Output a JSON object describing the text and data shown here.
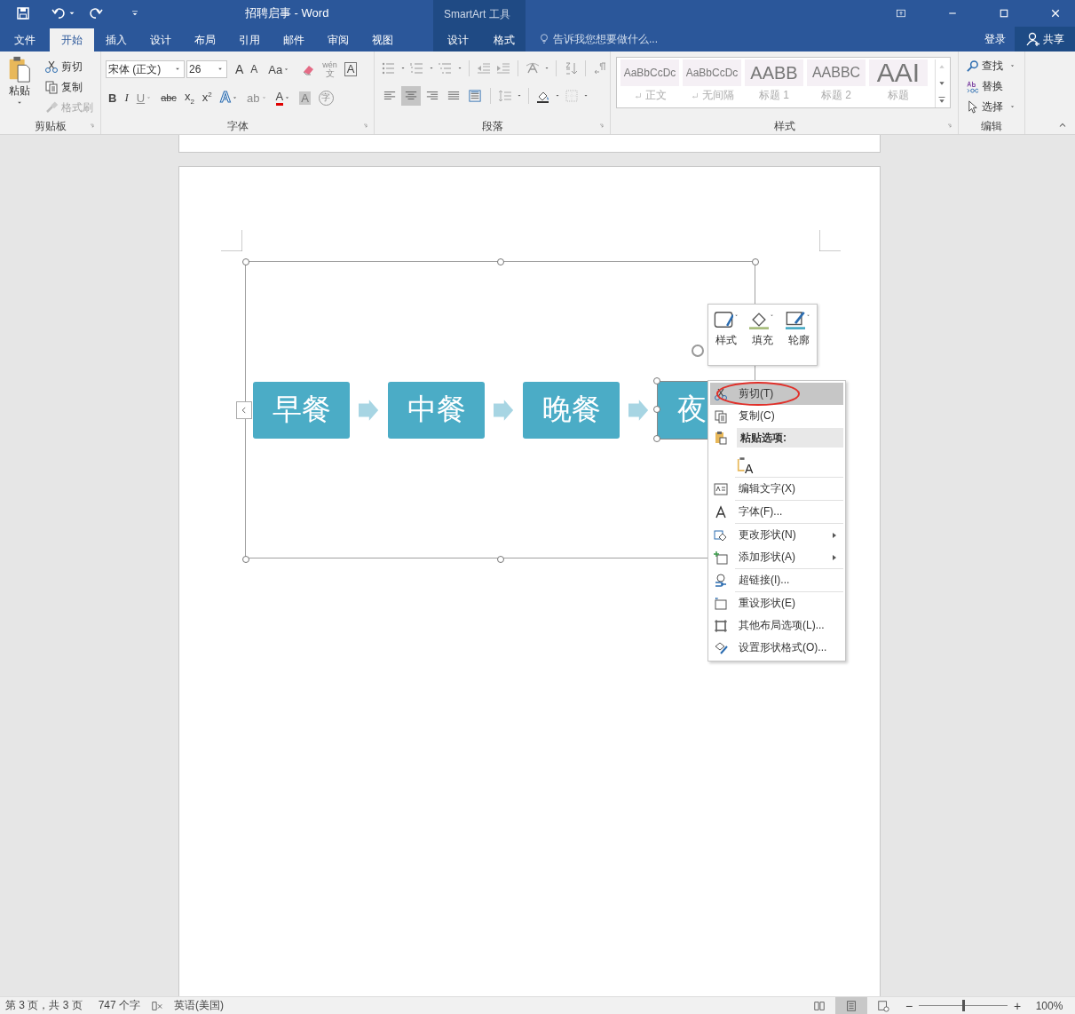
{
  "window": {
    "title": "招聘启事 - Word",
    "contextual_title": "SmartArt 工具",
    "tell_me": {
      "placeholder": "告诉我您想要做什么..."
    },
    "signin": "登录",
    "share": "共享"
  },
  "tabs": [
    {
      "label": "文件",
      "selected": false,
      "contextual": false
    },
    {
      "label": "开始",
      "selected": true,
      "contextual": false
    },
    {
      "label": "插入",
      "selected": false,
      "contextual": false
    },
    {
      "label": "设计",
      "selected": false,
      "contextual": false
    },
    {
      "label": "布局",
      "selected": false,
      "contextual": false
    },
    {
      "label": "引用",
      "selected": false,
      "contextual": false
    },
    {
      "label": "邮件",
      "selected": false,
      "contextual": false
    },
    {
      "label": "审阅",
      "selected": false,
      "contextual": false
    },
    {
      "label": "视图",
      "selected": false,
      "contextual": false
    },
    {
      "label": "设计",
      "selected": false,
      "contextual": true
    },
    {
      "label": "格式",
      "selected": false,
      "contextual": true
    }
  ],
  "ribbon": {
    "clipboard": {
      "label": "剪贴板",
      "paste": "粘贴",
      "items": [
        {
          "label": "剪切",
          "disabled": false
        },
        {
          "label": "复制",
          "disabled": false
        },
        {
          "label": "格式刷",
          "disabled": true
        }
      ]
    },
    "font": {
      "label": "字体",
      "name": "宋体 (正文)",
      "size": "26",
      "row1": [
        {
          "kind": "grow",
          "label": "A",
          "caret": false,
          "disabled": false
        },
        {
          "kind": "shrink",
          "label": "A",
          "caret": false,
          "disabled": false
        },
        {
          "kind": "case",
          "label": "Aa",
          "caret": true,
          "disabled": false
        },
        {
          "kind": "clear",
          "caret": false,
          "disabled": false
        },
        {
          "kind": "phonetic",
          "label": "wén",
          "sub": "文",
          "caret": false,
          "disabled": true
        },
        {
          "kind": "border",
          "label": "A",
          "caret": false,
          "disabled": false
        }
      ],
      "row2": [
        {
          "kind": "bold",
          "label": "B",
          "caret": false,
          "disabled": false
        },
        {
          "kind": "italic",
          "label": "I",
          "caret": false,
          "disabled": false
        },
        {
          "kind": "underline",
          "label": "U",
          "caret": true,
          "disabled": true
        },
        {
          "kind": "strike",
          "label": "abc",
          "caret": false,
          "disabled": false
        },
        {
          "kind": "subscript",
          "label": "x",
          "sub": "2",
          "caret": false,
          "disabled": false
        },
        {
          "kind": "superscript",
          "label": "x",
          "sup": "2",
          "caret": false,
          "disabled": false
        },
        {
          "kind": "effects",
          "label": "A",
          "caret": true,
          "disabled": false
        },
        {
          "kind": "highlight",
          "label": "ab",
          "caret": true,
          "disabled": true
        },
        {
          "kind": "color",
          "label": "A",
          "caret": true,
          "disabled": false
        },
        {
          "kind": "shading",
          "label": "A",
          "caret": false,
          "disabled": false
        },
        {
          "kind": "enclose",
          "label": "字",
          "caret": false,
          "disabled": false
        }
      ]
    },
    "paragraph": {
      "label": "段落",
      "align": [
        {
          "kind": "left",
          "selected": false
        },
        {
          "kind": "center",
          "selected": true
        },
        {
          "kind": "right",
          "selected": false
        },
        {
          "kind": "justify",
          "selected": false
        },
        {
          "kind": "distributed",
          "selected": false
        }
      ]
    },
    "styles": {
      "label": "样式",
      "items": [
        {
          "preview": "AaBbCcDc",
          "name": "正文",
          "kind": "body"
        },
        {
          "preview": "AaBbCcDc",
          "name": "无间隔",
          "kind": "body"
        },
        {
          "preview": "AABB",
          "name": "标题 1",
          "kind": "heading1"
        },
        {
          "preview": "AABBC",
          "name": "标题 2",
          "kind": "heading2"
        },
        {
          "preview": "AAI",
          "name": "标题",
          "kind": "title"
        }
      ]
    },
    "editing": {
      "label": "编辑",
      "items": [
        {
          "label": "查找",
          "caret": true
        },
        {
          "label": "替换",
          "caret": false
        },
        {
          "label": "选择",
          "caret": true
        }
      ]
    }
  },
  "document": {
    "smartart": {
      "shapes": [
        {
          "text": "早餐",
          "selected": false
        },
        {
          "text": "中餐",
          "selected": false
        },
        {
          "text": "晚餐",
          "selected": false
        },
        {
          "text": "夜",
          "selected": true
        }
      ]
    },
    "mini_toolbar": [
      {
        "label": "样式"
      },
      {
        "label": "填充"
      },
      {
        "label": "轮廓"
      }
    ],
    "context_menu": {
      "groups": [
        [
          {
            "kind": "item",
            "label": "剪切(T)",
            "selected": true,
            "circled": true,
            "submenu": false
          },
          {
            "kind": "item",
            "label": "复制(C)",
            "selected": false,
            "circled": false,
            "submenu": false
          },
          {
            "kind": "header",
            "label": "粘贴选项:"
          },
          {
            "kind": "paste-option",
            "label": "A"
          }
        ],
        [
          {
            "kind": "item",
            "label": "编辑文字(X)",
            "selected": false,
            "circled": false,
            "submenu": false
          }
        ],
        [
          {
            "kind": "item",
            "label": "字体(F)...",
            "selected": false,
            "circled": false,
            "submenu": false
          }
        ],
        [
          {
            "kind": "item",
            "label": "更改形状(N)",
            "selected": false,
            "circled": false,
            "submenu": true
          },
          {
            "kind": "item",
            "label": "添加形状(A)",
            "selected": false,
            "circled": false,
            "submenu": true
          }
        ],
        [
          {
            "kind": "item",
            "label": "超链接(I)...",
            "selected": false,
            "circled": false,
            "submenu": false
          }
        ],
        [
          {
            "kind": "item",
            "label": "重设形状(E)",
            "selected": false,
            "circled": false,
            "submenu": false
          },
          {
            "kind": "item",
            "label": "其他布局选项(L)...",
            "selected": false,
            "circled": false,
            "submenu": false
          },
          {
            "kind": "item",
            "label": "设置形状格式(O)...",
            "selected": false,
            "circled": false,
            "submenu": false
          }
        ]
      ]
    }
  },
  "status_bar": {
    "page": "第 3 页，共 3 页",
    "words": "747 个字",
    "language": "英语(美国)",
    "views": [
      {
        "kind": "read",
        "selected": false
      },
      {
        "kind": "print",
        "selected": true
      },
      {
        "kind": "web",
        "selected": false
      }
    ],
    "zoom_out": "−",
    "zoom_in": "+",
    "zoom": {
      "level": 0.5
    },
    "zoom_label": "100%"
  }
}
